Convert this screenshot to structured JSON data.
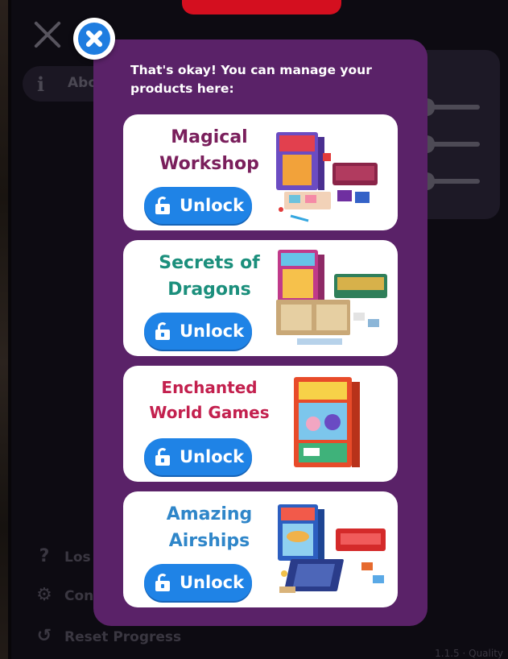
{
  "background": {
    "about_label": "Abo",
    "rows": [
      {
        "icon": "question-icon",
        "label": "Los"
      },
      {
        "icon": "gear-icon",
        "label": "Con"
      },
      {
        "icon": "reset-icon",
        "label": "Reset Progress"
      }
    ],
    "version": "1.1.5 · Quality"
  },
  "modal": {
    "title": "That's okay! You can manage your products here:",
    "products": [
      {
        "name_line1": "Magical",
        "name_line2": "Workshop",
        "color": "#7a1f5c",
        "unlock_label": "Unlock"
      },
      {
        "name_line1": "Secrets of",
        "name_line2": "Dragons",
        "color": "#1b8f7c",
        "unlock_label": "Unlock"
      },
      {
        "name_line1": "Enchanted",
        "name_line2": "World Games",
        "color": "#c3204e",
        "unlock_label": "Unlock"
      },
      {
        "name_line1": "Amazing",
        "name_line2": "Airships",
        "color": "#2f86c9",
        "unlock_label": "Unlock"
      }
    ]
  },
  "colors": {
    "modal_bg": "#5a2268",
    "accent_blue": "#1f83e6",
    "top_bar_red": "#d40f1f"
  }
}
